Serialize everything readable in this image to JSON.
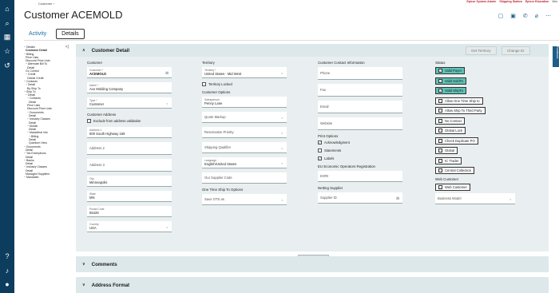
{
  "breadcrumb": "Customer  ›",
  "top_links": [
    "Epicor System Admin",
    "Shipping Station",
    "Epicor Education",
    "Wor"
  ],
  "page_title": "Customer ACEMOLD",
  "tabs": [
    "Activity",
    "Details"
  ],
  "tree": [
    "− Details",
    "Customer Detail",
    "− Billing",
    "Price Lists",
    "Discount Price Lists",
    "− Alternate Bill To",
    "Detail",
    "GL Control",
    "− Credit",
    "Global Credit",
    "− Contacts",
    "− Detail",
    "By Ship To",
    "− Ship To",
    "− Detail",
    "− Contacts",
    "Detail",
    "Price Lists",
    "Discount Price Lists",
    "− Documents",
    "Detail",
    "− Industry Classes",
    "Detail",
    "− Mobile",
    "Detail",
    "− MassMeal Info",
    "− Billing",
    "Detail",
    "Quantum View",
    "− Documents",
    "Detail",
    "− Tax Exemptions",
    "Detail",
    "− Banks",
    "Detail",
    "− Industry Classes",
    "Detail",
    "Managed Suppliers",
    "− Mandates"
  ],
  "sections": {
    "customer_detail": "Customer Detail",
    "comments": "Comments",
    "address_format": "Address Format"
  },
  "header_buttons": {
    "get_territory": "Get Territory",
    "change_id": "Change ID"
  },
  "col1": {
    "heading": "Customer",
    "customer_label": "Customer *",
    "customer_value": "ACEMOLD",
    "name_label": "Name *",
    "name_value": "Ace Molding Company",
    "type_label": "Type *",
    "type_value": "Customer",
    "address_heading": "Customer Address",
    "exclude_label": "Exclude from address validation",
    "addr1_label": "Address 1",
    "addr1_value": "600 South Highway 169",
    "addr2": "Address 2",
    "addr3": "Address 3",
    "city_label": "City",
    "city_value": "Minneapolis",
    "state_label": "State",
    "state_value": "MN",
    "postal_label": "Postal Code",
    "postal_value": "55426",
    "country_label": "Country",
    "country_value": "USA"
  },
  "col2": {
    "heading": "Territory",
    "territory_label": "Territory *",
    "territory_value": "United States - Mid West",
    "locked_label": "Territory Locked",
    "options_heading": "Customer Options",
    "sales_label": "Salesperson",
    "sales_value": "Penny Lane",
    "quote_markup": "Quote Markup",
    "reservation": "Reservation Priority",
    "shipping_qual": "Shipping Qualifier",
    "lang_label": "Language",
    "lang_value": "English/United States",
    "supplier_code": "Our Supplier Code",
    "otsto_heading": "One Time Ship To Options",
    "save_ots": "Save OTS as"
  },
  "col3": {
    "heading": "Customer Contact Information",
    "phone": "Phone",
    "fax": "Fax",
    "email": "Email",
    "website": "Website",
    "print_heading": "Print Options",
    "ack": "Acknowledgment",
    "statements": "Statements",
    "labels": "Labels",
    "eori_heading": "EU Economic Operators Registration",
    "eori": "EORI",
    "netting_heading": "Netting Supplier",
    "supplier_id": "Supplier ID"
  },
  "col4": {
    "heading": "Status",
    "statuses": [
      {
        "label": "Valid Payer",
        "on": true
      },
      {
        "label": "Valid SoldTo",
        "on": true
      },
      {
        "label": "Valid ShipTo",
        "on": true
      },
      {
        "label": "Allow One Time Ship to",
        "on": false
      },
      {
        "label": "Allow Ship To Third Party",
        "on": false
      },
      {
        "label": "No Contact",
        "on": false
      },
      {
        "label": "Global Lock",
        "on": false
      },
      {
        "label": "Check Duplicate PO",
        "on": false
      },
      {
        "label": "Global",
        "on": false
      },
      {
        "label": "IC Trader",
        "on": false
      },
      {
        "label": "Central Collection",
        "on": false
      }
    ],
    "web_heading": "Web Customer",
    "web_customer": "Web Customer",
    "business_model": "Business Model"
  },
  "full_screen": "Full Screen",
  "feedback": "Feedback",
  "colors": {
    "nav": "#0d3d5e",
    "accent": "#5cc3b6",
    "section": "#dde8ea"
  }
}
